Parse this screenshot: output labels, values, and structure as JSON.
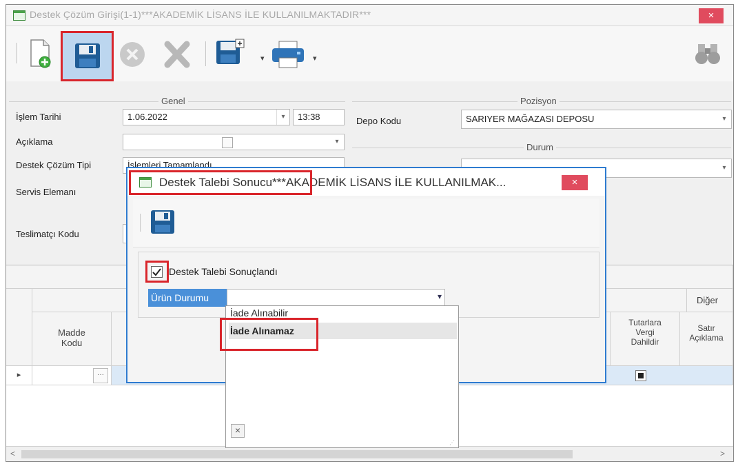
{
  "window": {
    "title": "Destek Çözüm Girişi(1-1)***AKADEMİK LİSANS İLE KULLANILMAKTADIR***",
    "close_label": "×"
  },
  "toolbar": {
    "items": [
      "new-document-icon",
      "save-icon",
      "cancel-circle-icon",
      "delete-x-icon",
      "save-as-icon",
      "print-icon",
      "binoculars-icon"
    ],
    "dropdown_caret": "▾"
  },
  "genel": {
    "group_title": "Genel",
    "islem_tarihi_label": "İşlem Tarihi",
    "islem_tarihi_value": "1.06.2022",
    "time_value": "13:38",
    "aciklama_label": "Açıklama",
    "destek_cozum_tipi_label": "Destek Çözüm Tipi",
    "destek_cozum_tipi_value": "İşlemleri Tamamlandı",
    "servis_elemani_label": "Servis Elemanı",
    "teslimatci_kodu_label": "Teslimatçı Kodu"
  },
  "pozisyon": {
    "group_title": "Pozisyon",
    "depo_kodu_label": "Depo Kodu",
    "depo_kodu_value": "SARIYER MAĞAZASI DEPOSU"
  },
  "durum": {
    "group_title": "Durum"
  },
  "grid": {
    "columns": {
      "madde_kodu": "Madde\nKodu",
      "tutarlara_vergi_dahildir": "Tutarlara\nVergi\nDahildir",
      "satir_aciklama": "Satır\nAçıklama",
      "diger_band": "Diğer"
    },
    "row_indicator": "▸",
    "ellipsis": "···"
  },
  "dialog": {
    "title": "Destek Talebi Sonucu***AKADEMİK LİSANS İLE KULLANILMAK...",
    "close_label": "×",
    "checkbox_label": "Destek Talebi Sonuçlandı",
    "checkbox_checked": true,
    "urun_durumu_label": "Ürün Durumu",
    "options": [
      "İade Alınabilir",
      "İade Alınamaz"
    ],
    "selected_option": "İade Alınamaz",
    "popup_close": "×"
  },
  "colors": {
    "highlight": "#d9252b",
    "close_red": "#e04b5e",
    "dialog_border": "#2e7bd0",
    "label_blue": "#4a90d9",
    "grid_row_selected": "#dbe9f7"
  }
}
